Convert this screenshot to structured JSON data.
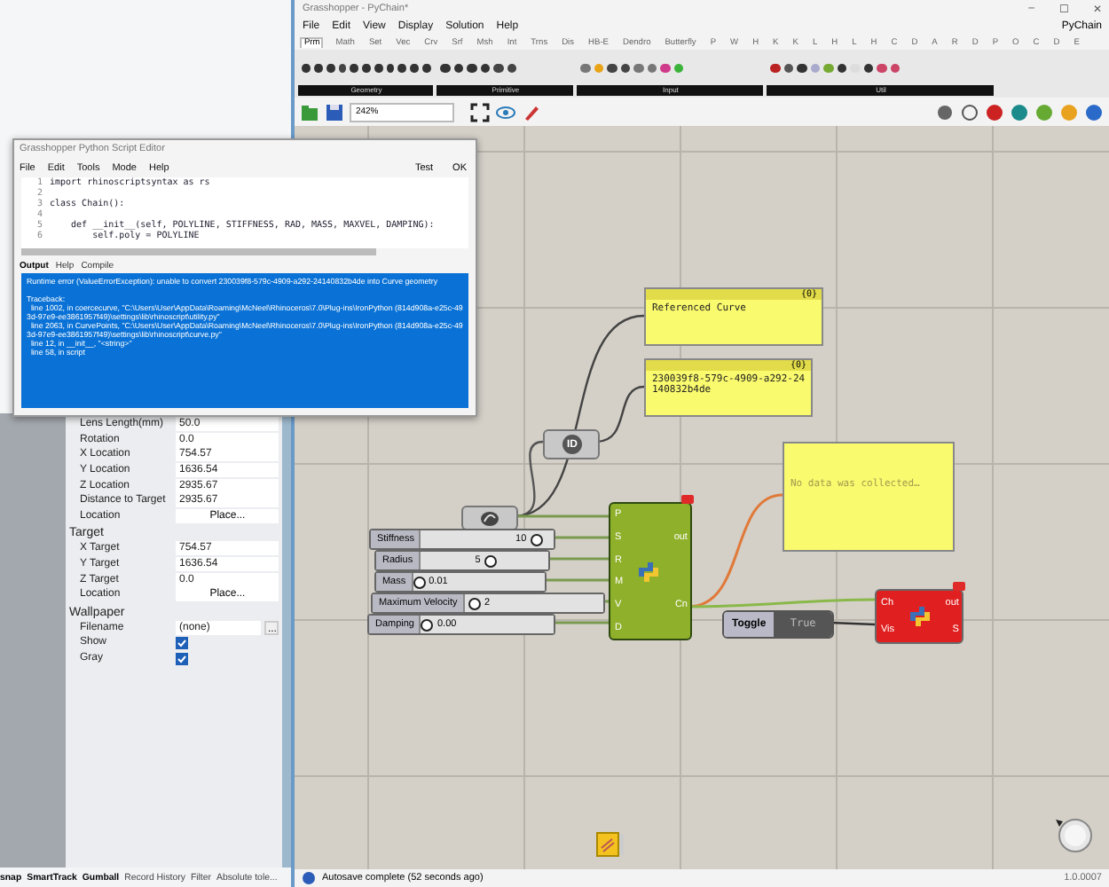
{
  "rhino": {
    "properties": {
      "rows": [
        {
          "kind": "value",
          "label": "Lens Length(mm)",
          "value": "50.0"
        },
        {
          "kind": "value",
          "label": "Rotation",
          "value": "0.0"
        },
        {
          "kind": "value",
          "label": "X Location",
          "value": "754.57"
        },
        {
          "kind": "value",
          "label": "Y Location",
          "value": "1636.54"
        },
        {
          "kind": "value",
          "label": "Z Location",
          "value": "2935.67"
        },
        {
          "kind": "value",
          "label": "Distance to Target",
          "value": "2935.67"
        },
        {
          "kind": "button",
          "label": "Location",
          "value": "Place..."
        }
      ],
      "sections": [
        {
          "title": "Target",
          "rows": [
            {
              "kind": "value",
              "label": "X Target",
              "value": "754.57"
            },
            {
              "kind": "value",
              "label": "Y Target",
              "value": "1636.54"
            },
            {
              "kind": "value",
              "label": "Z Target",
              "value": "0.0"
            },
            {
              "kind": "button",
              "label": "Location",
              "value": "Place..."
            }
          ]
        },
        {
          "title": "Wallpaper",
          "rows": [
            {
              "kind": "file",
              "label": "Filename",
              "value": "(none)",
              "button": "..."
            },
            {
              "kind": "check",
              "label": "Show",
              "checked": true
            },
            {
              "kind": "check",
              "label": "Gray",
              "checked": true
            }
          ]
        }
      ]
    },
    "status_bar": [
      {
        "label": "snap",
        "on": true
      },
      {
        "label": "SmartTrack",
        "on": true
      },
      {
        "label": "Gumball",
        "on": true
      },
      {
        "label": "Record History",
        "on": false
      },
      {
        "label": "Filter",
        "on": false
      },
      {
        "label": "Absolute tole...",
        "on": false
      }
    ]
  },
  "grasshopper": {
    "title": "Grasshopper - PyChain*",
    "window_controls": [
      "–",
      "☐",
      "✕"
    ],
    "menu": [
      "File",
      "Edit",
      "View",
      "Display",
      "Solution",
      "Help"
    ],
    "document": "PyChain",
    "tabs": [
      {
        "label": "Prm",
        "selected": true
      },
      {
        "label": "Math",
        "selected": false
      },
      {
        "label": "Set",
        "selected": false
      },
      {
        "label": "Vec",
        "selected": false
      },
      {
        "label": "Crv",
        "selected": false
      },
      {
        "label": "Srf",
        "selected": false
      },
      {
        "label": "Msh",
        "selected": false
      },
      {
        "label": "Int",
        "selected": false
      },
      {
        "label": "Trns",
        "selected": false
      },
      {
        "label": "Dis",
        "selected": false
      },
      {
        "label": "HB-E",
        "selected": false
      },
      {
        "label": "Dendro",
        "selected": false
      },
      {
        "label": "Butterfly",
        "selected": false
      },
      {
        "label": "P",
        "selected": false
      },
      {
        "label": "W",
        "selected": false
      },
      {
        "label": "H",
        "selected": false
      },
      {
        "label": "K",
        "selected": false
      },
      {
        "label": "K",
        "selected": false
      },
      {
        "label": "L",
        "selected": false
      },
      {
        "label": "H",
        "selected": false
      },
      {
        "label": "L",
        "selected": false
      },
      {
        "label": "H",
        "selected": false
      },
      {
        "label": "C",
        "selected": false
      },
      {
        "label": "D",
        "selected": false
      },
      {
        "label": "A",
        "selected": false
      },
      {
        "label": "R",
        "selected": false
      },
      {
        "label": "D",
        "selected": false
      },
      {
        "label": "P",
        "selected": false
      },
      {
        "label": "O",
        "selected": false
      },
      {
        "label": "C",
        "selected": false
      },
      {
        "label": "D",
        "selected": false
      },
      {
        "label": "E",
        "selected": false
      }
    ],
    "ribbon_groups": [
      "Geometry",
      "Primitive",
      "Input",
      "Util"
    ],
    "zoom": "242%",
    "canvas": {
      "panels": [
        {
          "header": "{0}",
          "text": "Referenced Curve"
        },
        {
          "header": "{0}",
          "text": "230039f8-579c-4909-a292-24140832b4de"
        },
        {
          "text": "No data was collected…"
        }
      ],
      "id_node": "ID",
      "sliders": [
        {
          "label": "Stiffness",
          "value": "10",
          "level": 0.9
        },
        {
          "label": "Radius",
          "value": "5",
          "level": 0.55
        },
        {
          "label": "Mass",
          "value": "0.01",
          "level": 0.0
        },
        {
          "label": "Maximum Velocity",
          "value": "2",
          "level": 0.03
        },
        {
          "label": "Damping",
          "value": "0.00",
          "level": 0.0
        }
      ],
      "components": [
        {
          "selected": true,
          "error": false,
          "inputs": [
            "P",
            "S",
            "R",
            "M",
            "V",
            "D"
          ],
          "outputs": [
            "out",
            "Cn"
          ]
        },
        {
          "selected": false,
          "error": true,
          "inputs": [
            "Ch",
            "Vis"
          ],
          "outputs": [
            "out",
            "S"
          ]
        }
      ],
      "toggle": {
        "label": "Toggle",
        "value": "True"
      }
    },
    "status": "Autosave complete (52 seconds ago)",
    "version": "1.0.0007"
  },
  "script_editor": {
    "title": "Grasshopper Python Script Editor",
    "menu": [
      "File",
      "Edit",
      "Tools",
      "Mode",
      "Help"
    ],
    "actions": [
      "Test",
      "OK"
    ],
    "code": [
      {
        "n": "1",
        "text": "import rhinoscriptsyntax as rs"
      },
      {
        "n": "2"
      },
      {
        "n": "3",
        "text": "class Chain():"
      },
      {
        "n": "4"
      },
      {
        "n": "5",
        "text": "    def __init__(self, POLYLINE, STIFFNESS, RAD, MASS, MAXVEL, DAMPING):"
      },
      {
        "n": "6",
        "text": "        self.poly = POLYLINE"
      }
    ],
    "output_tabs": [
      {
        "label": "Output",
        "selected": true
      },
      {
        "label": "Help",
        "selected": false
      },
      {
        "label": "Compile",
        "selected": false
      }
    ],
    "output": [
      [
        "Runtime error (ValueErrorException): unable to convert 230039f8-579c-4909-a292-24140832b4de into Curve geometry"
      ],
      [
        "Traceback:",
        "  line 1002, in coercecurve, \"C:\\Users\\User\\AppData\\Roaming\\McNeel\\Rhinoceros\\7.0\\Plug-ins\\IronPython (814d908a-e25c-493d-97e9-ee3861957f49)\\settings\\lib\\rhinoscript\\utility.py\"",
        "  line 2063, in CurvePoints, \"C:\\Users\\User\\AppData\\Roaming\\McNeel\\Rhinoceros\\7.0\\Plug-ins\\IronPython (814d908a-e25c-493d-97e9-ee3861957f49)\\settings\\lib\\rhinoscript\\curve.py\"",
        "  line 12, in __init__, \"<string>\"",
        "  line 58, in script"
      ]
    ]
  }
}
